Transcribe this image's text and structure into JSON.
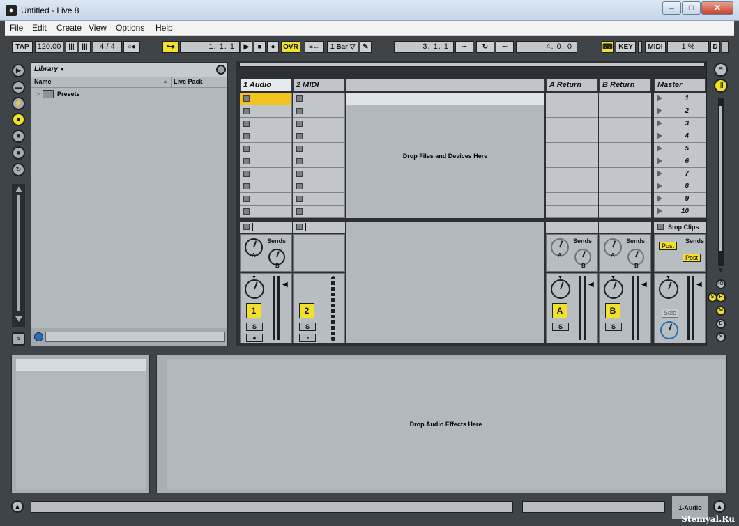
{
  "window": {
    "title": "Untitled - Live 8",
    "minimize": "–",
    "maximize": "□",
    "close": "✕"
  },
  "menu": [
    "File",
    "Edit",
    "Create",
    "View",
    "Options",
    "Help"
  ],
  "transport": {
    "tap": "TAP",
    "tempo": "120.00",
    "meter_num": "4",
    "meter_den": "4",
    "ovr": "OVR",
    "position": "1.   1.   1",
    "quantize": "1 Bar",
    "loop_start": "3.   1.   1",
    "loop_length": "4.   0.   0",
    "key": "KEY",
    "midi": "MIDI",
    "cpu": "1 %",
    "disk": "D"
  },
  "browser": {
    "title": "Library",
    "columns": [
      "Name",
      "Live Pack"
    ],
    "items": [
      "Presets"
    ],
    "search_placeholder": ""
  },
  "session": {
    "tracks": [
      "1 Audio",
      "2 MIDI"
    ],
    "returns": [
      "A Return",
      "B Return"
    ],
    "master": "Master",
    "drop_text": "Drop Files and Devices Here",
    "scenes": [
      "1",
      "2",
      "3",
      "4",
      "5",
      "6",
      "7",
      "8",
      "9",
      "10"
    ],
    "stop_clips": "Stop Clips",
    "sends_label": "Sends",
    "send_a": "A",
    "send_b": "B",
    "track_numbers": [
      "1",
      "2"
    ],
    "return_letters": [
      "A",
      "B"
    ],
    "solo_label": "S",
    "post_label": "Post",
    "master_solo": "Solo"
  },
  "detail": {
    "drop_text": "Drop Audio Effects Here"
  },
  "status": {
    "track_name": "1-Audio"
  },
  "watermark": "Stemyal.Ru",
  "colors": {
    "accent": "#f1e12a",
    "selected_clip": "#f2c21d",
    "panel": "#b8bdc1"
  }
}
